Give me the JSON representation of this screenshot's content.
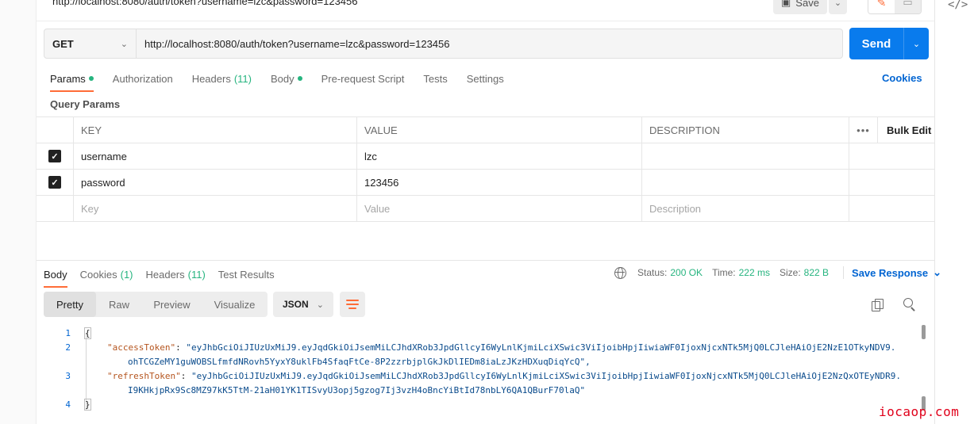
{
  "top": {
    "url_text": "http://localhost:8080/auth/token?username=lzc&password=123456",
    "save_label": "Save",
    "edit_icon": "pencil-icon",
    "comment_icon": "comment-icon"
  },
  "request": {
    "method": "GET",
    "url": "http://localhost:8080/auth/token?username=lzc&password=123456",
    "send_label": "Send"
  },
  "request_tabs": [
    {
      "label": "Params",
      "dot": true,
      "active": true
    },
    {
      "label": "Authorization"
    },
    {
      "label": "Headers",
      "count": "(11)"
    },
    {
      "label": "Body",
      "dot": true
    },
    {
      "label": "Pre-request Script"
    },
    {
      "label": "Tests"
    },
    {
      "label": "Settings"
    }
  ],
  "cookies_link": "Cookies",
  "query_params_title": "Query Params",
  "params_table": {
    "headers": {
      "key": "KEY",
      "value": "VALUE",
      "description": "DESCRIPTION",
      "more": "•••",
      "bulk_edit": "Bulk Edit"
    },
    "rows": [
      {
        "checked": true,
        "key": "username",
        "value": "lzc",
        "description": ""
      },
      {
        "checked": true,
        "key": "password",
        "value": "123456",
        "description": ""
      }
    ],
    "placeholders": {
      "key": "Key",
      "value": "Value",
      "description": "Description"
    }
  },
  "response_tabs": [
    {
      "label": "Body",
      "active": true
    },
    {
      "label": "Cookies",
      "count": "(1)"
    },
    {
      "label": "Headers",
      "count": "(11)"
    },
    {
      "label": "Test Results"
    }
  ],
  "status": {
    "status_label": "Status:",
    "status_value": "200 OK",
    "time_label": "Time:",
    "time_value": "222 ms",
    "size_label": "Size:",
    "size_value": "822 B",
    "save_response": "Save Response"
  },
  "view_modes": [
    "Pretty",
    "Raw",
    "Preview",
    "Visualize"
  ],
  "active_view": "Pretty",
  "format": "JSON",
  "code": {
    "line_numbers": [
      "1",
      "2",
      "3",
      "4"
    ],
    "open_brace": "{",
    "close_brace": "}",
    "access_key": "\"accessToken\"",
    "access_val_1": "\"eyJhbGciOiJIUzUxMiJ9.eyJqdGkiOiJsemMiLCJhdXRob3JpdGllcyI6WyLnlKjmiLciXSwic3ViIjoibHpjIiwiaWF0IjoxNjcxNTk5MjQ0LCJleHAiOjE2NzE1OTkyNDV9.",
    "access_val_2": "ohTCGZeMY1guWOBSLfmfdNRovh5YyxY8uklFb4SfaqFtCe-8P2zzrbjplGkJkDlIEDm8iaLzJKzHDXuqDiqYcQ\",",
    "refresh_key": "\"refreshToken\"",
    "refresh_val_1": "\"eyJhbGciOiJIUzUxMiJ9.eyJqdGkiOiJsemMiLCJhdXRob3JpdGllcyI6WyLnlKjmiLciXSwic3ViIjoibHpjIiwiaWF0IjoxNjcxNTk5MjQ0LCJleHAiOjE2NzQxOTEyNDR9.",
    "refresh_val_2": "I9KHkjpRx9Sc8MZ97kK5TtM-21aH01YK1TISvyU3opj5gzog7Ij3vzH4oBncYiBtId78nbLY6QA1QBurF70laQ\""
  },
  "watermark": "iocaop.com",
  "colors": {
    "accent": "#ff6c37",
    "send": "#097bed",
    "link": "#0265d2",
    "ok": "#26b47f"
  }
}
